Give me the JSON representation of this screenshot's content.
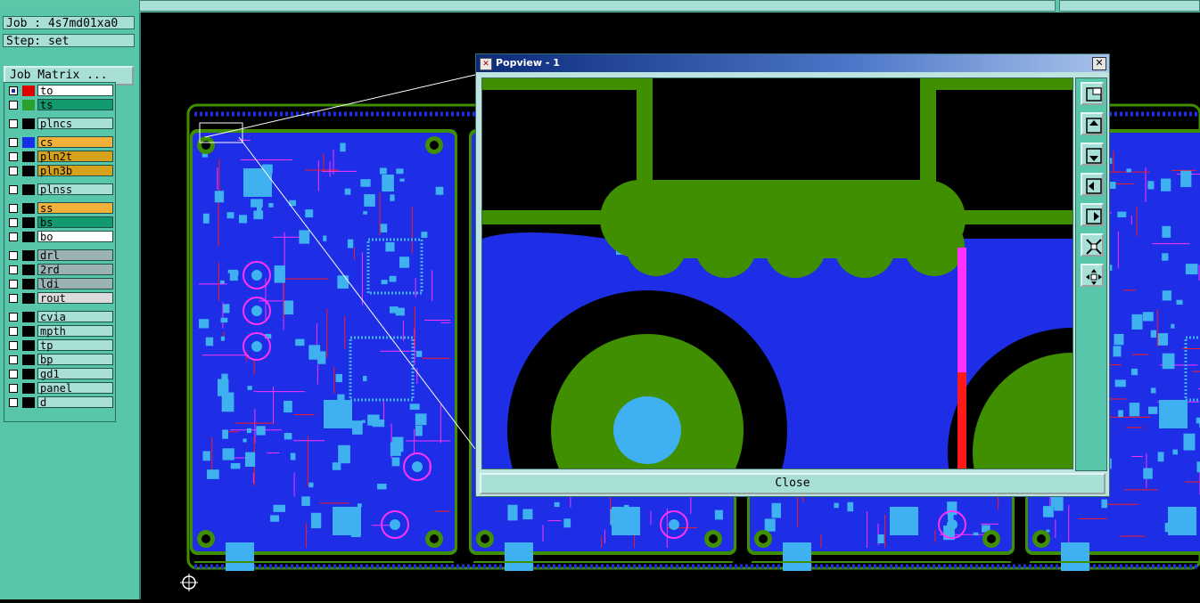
{
  "header": {
    "job_label": "Job : 4s7md01xa0",
    "step_label": "Step: set"
  },
  "job_matrix": {
    "label": "Job Matrix ..."
  },
  "layers": [
    {
      "name": "to",
      "color": "#ffffff",
      "swatch": "#e00000",
      "checked": true,
      "group": 0
    },
    {
      "name": "ts",
      "color": "#129a6e",
      "swatch": "#2b9f2b",
      "checked": false,
      "group": 0
    },
    {
      "name": "plncs",
      "color": "#a8e0d8",
      "swatch": "#000000",
      "checked": false,
      "group": 1
    },
    {
      "name": "cs",
      "color": "#f2b13a",
      "swatch": "#1530e6",
      "checked": false,
      "group": 2
    },
    {
      "name": "pln2t",
      "color": "#d6a21c",
      "swatch": "#000000",
      "checked": false,
      "group": 2
    },
    {
      "name": "pln3b",
      "color": "#d6a21c",
      "swatch": "#000000",
      "checked": false,
      "group": 2
    },
    {
      "name": "plnss",
      "color": "#a8e0d8",
      "swatch": "#000000",
      "checked": false,
      "group": 3
    },
    {
      "name": "ss",
      "color": "#f2b13a",
      "swatch": "#000000",
      "checked": false,
      "group": 4
    },
    {
      "name": "bs",
      "color": "#129a6e",
      "swatch": "#000000",
      "checked": false,
      "group": 4
    },
    {
      "name": "bo",
      "color": "#ffffff",
      "swatch": "#000000",
      "checked": false,
      "group": 4
    },
    {
      "name": "drl",
      "color": "#9bb3b3",
      "swatch": "#000000",
      "checked": false,
      "group": 5
    },
    {
      "name": "2rd",
      "color": "#9bb3b3",
      "swatch": "#000000",
      "checked": false,
      "group": 5
    },
    {
      "name": "ldi",
      "color": "#9bb3b3",
      "swatch": "#000000",
      "checked": false,
      "group": 5
    },
    {
      "name": "rout",
      "color": "#dcdcdc",
      "swatch": "#000000",
      "checked": false,
      "group": 5
    },
    {
      "name": "cvia",
      "color": "#a8e0d8",
      "swatch": "#000000",
      "checked": false,
      "group": 6
    },
    {
      "name": "mpth",
      "color": "#a8e0d8",
      "swatch": "#000000",
      "checked": false,
      "group": 6
    },
    {
      "name": "tp",
      "color": "#a8e0d8",
      "swatch": "#000000",
      "checked": false,
      "group": 6
    },
    {
      "name": "bp",
      "color": "#a8e0d8",
      "swatch": "#000000",
      "checked": false,
      "group": 6
    },
    {
      "name": "gd1",
      "color": "#a8e0d8",
      "swatch": "#000000",
      "checked": false,
      "group": 6
    },
    {
      "name": "panel",
      "color": "#a8e0d8",
      "swatch": "#000000",
      "checked": false,
      "group": 6
    },
    {
      "name": "d",
      "color": "#a8e0d8",
      "swatch": "#000000",
      "checked": false,
      "group": 6
    }
  ],
  "popview": {
    "title": "Popview - 1",
    "close_label": "Close",
    "toolbar": [
      "zoom-box-icon",
      "pan-up-icon",
      "pan-down-icon",
      "pan-left-icon",
      "pan-right-icon",
      "zoom-fit-icon",
      "center-icon"
    ]
  },
  "colors": {
    "board_blue": "#1d2ee6",
    "copper_green": "#3f8f00",
    "pad_cyan": "#3fb0f0",
    "trace_red": "#ff1a1a",
    "trace_magenta": "#ff33ff",
    "panel_bg": "#57c6aa"
  }
}
